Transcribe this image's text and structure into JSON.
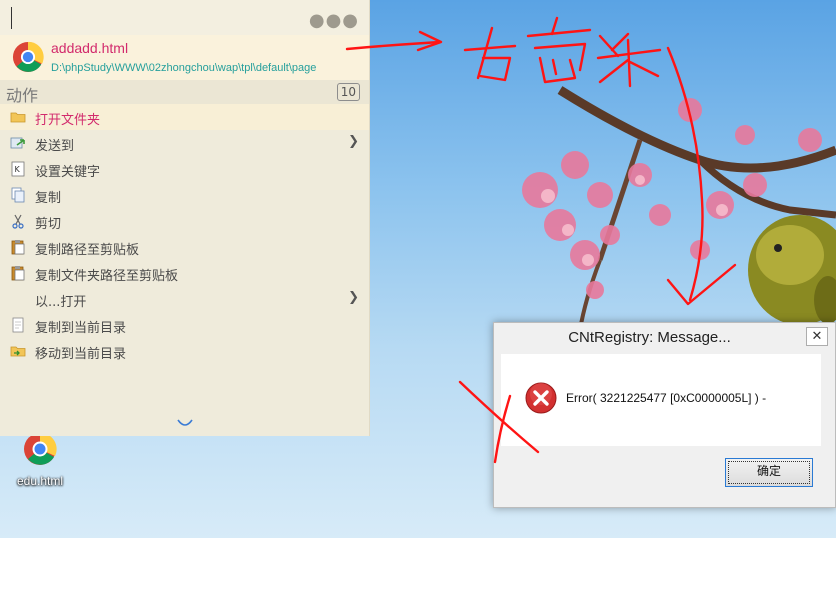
{
  "launcher": {
    "search_value": "",
    "more_icon": "more-dots-icon",
    "result": {
      "title": "addadd.html",
      "path": "D:\\phpStudy\\WWW\\02zhongchou\\wap\\tpl\\default\\page",
      "icon": "chrome-icon"
    },
    "section": {
      "title": "动作",
      "count": "10"
    },
    "actions": [
      {
        "label": "打开文件夹",
        "icon": "folder-icon"
      },
      {
        "label": "发送到",
        "icon": "send-icon"
      },
      {
        "label": "设置关键字",
        "icon": "keyword-icon"
      },
      {
        "label": "复制",
        "icon": "copy-icon"
      },
      {
        "label": "剪切",
        "icon": "scissors-icon"
      },
      {
        "label": "复制路径至剪贴板",
        "icon": "clipboard-icon"
      },
      {
        "label": "复制文件夹路径至剪贴板",
        "icon": "clipboard-icon"
      },
      {
        "label": "以...打开",
        "icon": ""
      },
      {
        "label": "复制到当前目录",
        "icon": "copy-file-icon"
      },
      {
        "label": "移动到当前目录",
        "icon": "move-file-icon"
      }
    ]
  },
  "desktop": {
    "icon_label": "edu.html",
    "icon": "chrome-icon"
  },
  "dialog": {
    "title": "CNtRegistry: Message...",
    "close": "✕",
    "message": "Error( 3221225477 [0xC0000005L] ) -",
    "ok_label": "确定",
    "icon": "error-icon"
  },
  "colors": {
    "accent_pink": "#d22a6c",
    "path_teal": "#259f9c",
    "annotation_red": "#ff1414",
    "panel_bg": "#efebdb"
  }
}
